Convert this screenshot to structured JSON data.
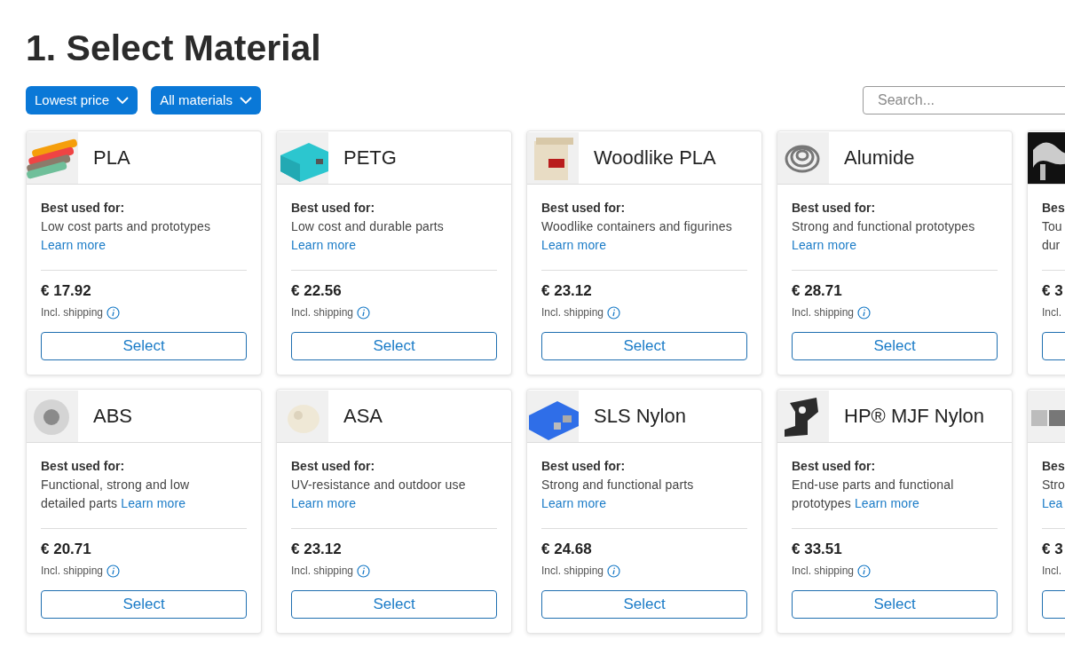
{
  "title": "1. Select Material",
  "filters": [
    {
      "label": "Lowest price"
    },
    {
      "label": "All materials"
    }
  ],
  "search": {
    "placeholder": "Search..."
  },
  "rows": [
    {
      "cards": [
        {
          "kind": "full",
          "name": "PLA",
          "best_label": "Best used for:",
          "description": "Low cost parts and prototypes",
          "link": "Learn more",
          "price": "€ 17.92",
          "shipping": "Incl. shipping",
          "button": "Select"
        },
        {
          "kind": "full",
          "name": "PETG",
          "best_label": "Best used for:",
          "description": "Low cost and durable parts",
          "link": "Learn more",
          "price": "€ 22.56",
          "shipping": "Incl. shipping",
          "button": "Select"
        },
        {
          "kind": "full",
          "name": "Woodlike PLA",
          "best_label": "Best used for:",
          "description": "Woodlike containers and figurines",
          "link": "Learn more",
          "price": "€ 23.12",
          "shipping": "Incl. shipping",
          "button": "Select"
        },
        {
          "kind": "full",
          "name": "Alumide",
          "best_label": "Best used for:",
          "description": "Strong and functional prototypes",
          "link": "Learn more",
          "price": "€ 28.71",
          "shipping": "Incl. shipping",
          "button": "Select"
        },
        {
          "kind": "partial",
          "best_label": "Bes",
          "description_lines": [
            {
              "kind": "text",
              "text": "Tou"
            },
            {
              "kind": "text",
              "text": "dur"
            }
          ],
          "price": "€ 3",
          "shipping": "Incl."
        }
      ]
    },
    {
      "cards": [
        {
          "kind": "full",
          "name": "ABS",
          "best_label": "Best used for:",
          "description": "Functional, strong and low detailed parts",
          "link": "Learn more",
          "price": "€ 20.71",
          "shipping": "Incl. shipping",
          "button": "Select"
        },
        {
          "kind": "full",
          "name": "ASA",
          "best_label": "Best used for:",
          "description": "UV-resistance and outdoor use",
          "link": "Learn more",
          "price": "€ 23.12",
          "shipping": "Incl. shipping",
          "button": "Select"
        },
        {
          "kind": "full",
          "name": "SLS Nylon",
          "best_label": "Best used for:",
          "description": "Strong and functional parts",
          "link": "Learn more",
          "price": "€ 24.68",
          "shipping": "Incl. shipping",
          "button": "Select"
        },
        {
          "kind": "full",
          "name": "HP® MJF Nylon",
          "best_label": "Best used for:",
          "description": "End-use parts and functional prototypes",
          "link": "Learn more",
          "price": "€ 33.51",
          "shipping": "Incl. shipping",
          "button": "Select"
        },
        {
          "kind": "partial",
          "best_label": "Bes",
          "description_lines": [
            {
              "kind": "text",
              "text": "Stro"
            },
            {
              "kind": "link",
              "text": "Lea"
            }
          ],
          "price": "€ 3",
          "shipping": "Incl."
        }
      ]
    }
  ]
}
